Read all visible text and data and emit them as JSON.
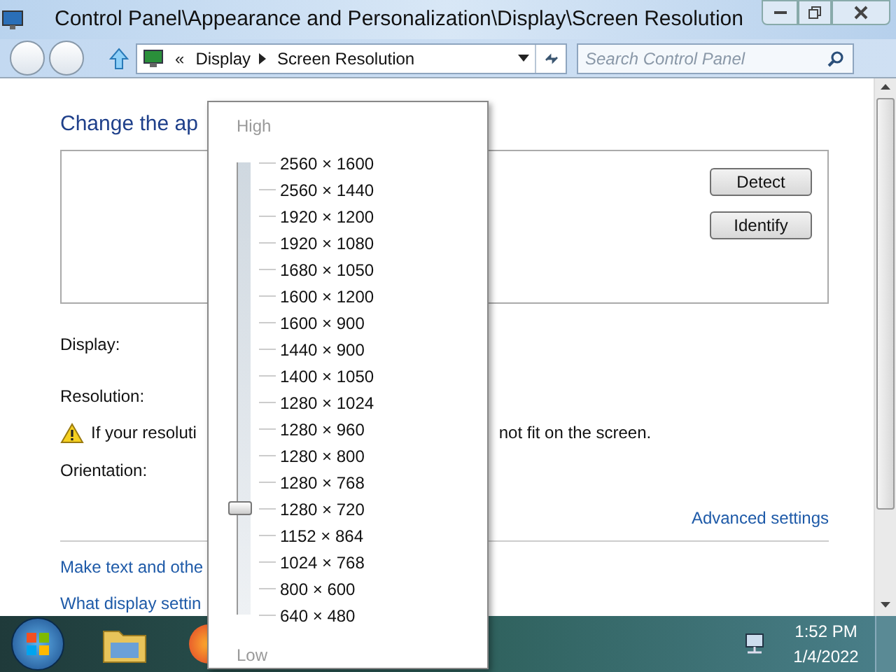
{
  "window": {
    "title": "Control Panel\\Appearance and Personalization\\Display\\Screen Resolution"
  },
  "address": {
    "prefix": "«",
    "breadcrumb": [
      {
        "label": "Display"
      },
      {
        "label": "Screen Resolution"
      }
    ]
  },
  "search": {
    "placeholder": "Search Control Panel"
  },
  "content": {
    "heading": "Change the ap",
    "buttons": [
      "Detect",
      "Identify"
    ],
    "labels": [
      "Display:",
      "Resolution:"
    ],
    "warning": {
      "left": "If your resoluti",
      "right": "not fit on the screen."
    },
    "orientation_label": "Orientation:",
    "advanced_link": "Advanced settings",
    "links": [
      "Make text and othe",
      "What display settin"
    ]
  },
  "resolution_popup": {
    "high_label": "High",
    "low_label": "Low",
    "level": 0.235,
    "options": [
      "2560 × 1600",
      "2560 × 1440",
      "1920 × 1200",
      "1920 × 1080",
      "1680 × 1050",
      "1600 × 1200",
      "1600 × 900",
      "1440 × 900",
      "1400 × 1050",
      "1280 × 1024",
      "1280 × 960",
      "1280 × 800",
      "1280 × 768",
      "1280 × 720",
      "1152 × 864",
      "1024 × 768",
      "800 × 600",
      "640 × 480"
    ]
  },
  "taskbar": {
    "time": "1:52 PM",
    "date": "1/4/2022"
  }
}
